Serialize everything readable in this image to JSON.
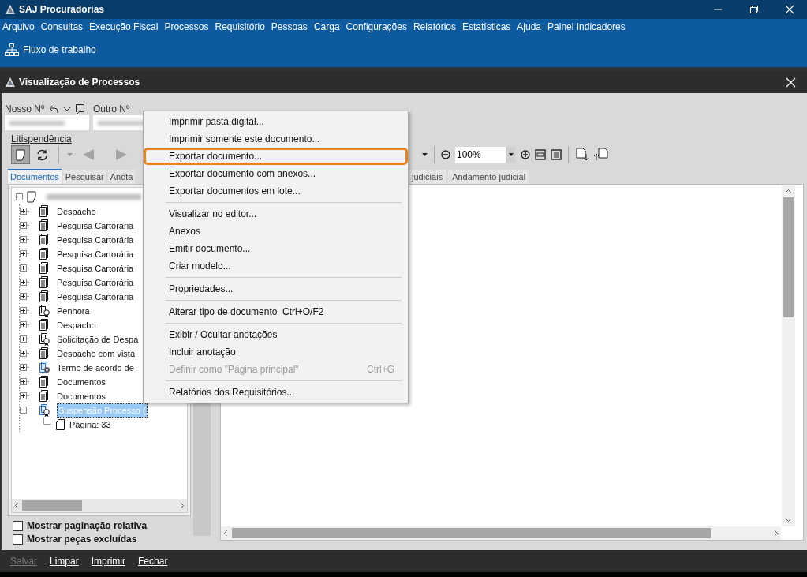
{
  "window": {
    "title": "SAJ Procuradorias"
  },
  "menu_bar": [
    "Arquivo",
    "Consultas",
    "Execução Fiscal",
    "Processos",
    "Requisitório",
    "Pessoas",
    "Carga",
    "Configurações",
    "Relatórios",
    "Estatísticas",
    "Ajuda",
    "Painel Indicadores"
  ],
  "toolbar": {
    "label": "Fluxo de trabalho"
  },
  "inner_window": {
    "title": "Visualização de Processos"
  },
  "fields": [
    {
      "label": "Nosso Nº"
    },
    {
      "label": "Outro Nº"
    }
  ],
  "link": "Litispendência",
  "left_tabs": [
    {
      "label": "Documentos",
      "selected": true
    },
    {
      "label": "Pesquisar",
      "selected": false
    },
    {
      "label": "Anota",
      "selected": false
    }
  ],
  "tree": {
    "expanded": true,
    "children": [
      {
        "label": "Despacho",
        "kind": "document",
        "expanded": false,
        "selected": false
      },
      {
        "label": "Pesquisa Cartorária",
        "kind": "document",
        "expanded": false,
        "selected": false
      },
      {
        "label": "Pesquisa Cartorária",
        "kind": "document",
        "expanded": false,
        "selected": false
      },
      {
        "label": "Pesquisa Cartorária",
        "kind": "document",
        "expanded": false,
        "selected": false
      },
      {
        "label": "Pesquisa Cartorária",
        "kind": "document",
        "expanded": false,
        "selected": false
      },
      {
        "label": "Pesquisa Cartorária",
        "kind": "document",
        "expanded": false,
        "selected": false
      },
      {
        "label": "Pesquisa Cartorária",
        "kind": "document",
        "expanded": false,
        "selected": false
      },
      {
        "label": "Penhora",
        "kind": "seal",
        "expanded": false,
        "selected": false
      },
      {
        "label": "Despacho",
        "kind": "document",
        "expanded": false,
        "selected": false
      },
      {
        "label": "Solicitação de Despa",
        "kind": "seal",
        "expanded": false,
        "selected": false
      },
      {
        "label": "Despacho com vista",
        "kind": "document",
        "expanded": false,
        "selected": false
      },
      {
        "label": "Termo de acordo de",
        "kind": "gear-seal",
        "expanded": false,
        "selected": false
      },
      {
        "label": "Documentos",
        "kind": "document",
        "expanded": false,
        "selected": false
      },
      {
        "label": "Documentos",
        "kind": "document",
        "expanded": false,
        "selected": false
      },
      {
        "label": "Suspensão Processo (",
        "kind": "blue-seal",
        "expanded": true,
        "selected": true,
        "children": [
          {
            "label": "Página: 33",
            "kind": "page",
            "selected": false
          }
        ]
      }
    ]
  },
  "checkboxes": [
    {
      "label": "Mostrar paginação relativa",
      "checked": false
    },
    {
      "label": "Mostrar peças excluídas",
      "checked": false
    }
  ],
  "zoom": {
    "value": "100%"
  },
  "right_tabs": [
    {
      "label": "judiciais",
      "selected": false
    },
    {
      "label": "Andamento judicial",
      "selected": false
    }
  ],
  "context_menu": [
    {
      "kind": "item",
      "label": "Imprimir pasta digital...",
      "disabled": false,
      "highlighted": false
    },
    {
      "kind": "item",
      "label": "Imprimir somente este documento...",
      "disabled": false,
      "highlighted": false
    },
    {
      "kind": "item",
      "label": "Exportar documento...",
      "disabled": false,
      "highlighted": true
    },
    {
      "kind": "item",
      "label": "Exportar documento com anexos...",
      "disabled": false,
      "highlighted": false
    },
    {
      "kind": "item",
      "label": "Exportar documentos em lote...",
      "disabled": false,
      "highlighted": false
    },
    {
      "kind": "separator"
    },
    {
      "kind": "item",
      "label": "Visualizar no editor...",
      "disabled": false,
      "highlighted": false
    },
    {
      "kind": "item",
      "label": "Anexos",
      "disabled": false,
      "highlighted": false
    },
    {
      "kind": "item",
      "label": "Emitir documento...",
      "disabled": false,
      "highlighted": false
    },
    {
      "kind": "item",
      "label": "Criar modelo...",
      "disabled": false,
      "highlighted": false
    },
    {
      "kind": "separator"
    },
    {
      "kind": "item",
      "label": "Propriedades...",
      "disabled": false,
      "highlighted": false
    },
    {
      "kind": "separator"
    },
    {
      "kind": "item",
      "label": "Alterar tipo de documento  Ctrl+O/F2",
      "disabled": false,
      "highlighted": false
    },
    {
      "kind": "separator"
    },
    {
      "kind": "item",
      "label": "Exibir / Ocultar anotações",
      "disabled": false,
      "highlighted": false
    },
    {
      "kind": "item",
      "label": "Incluir anotação",
      "disabled": false,
      "highlighted": false
    },
    {
      "kind": "item",
      "label": "Definir como \"Página principal\"",
      "shortcut": "Ctrl+G",
      "disabled": true,
      "highlighted": false
    },
    {
      "kind": "separator"
    },
    {
      "kind": "item",
      "label": "Relatórios dos Requisitórios...",
      "disabled": false,
      "highlighted": false
    }
  ],
  "bottom_buttons": [
    {
      "label": "Salvar",
      "disabled": true
    },
    {
      "label": "Limpar",
      "disabled": false
    },
    {
      "label": "Imprimir",
      "disabled": false
    },
    {
      "label": "Fechar",
      "disabled": false
    }
  ]
}
